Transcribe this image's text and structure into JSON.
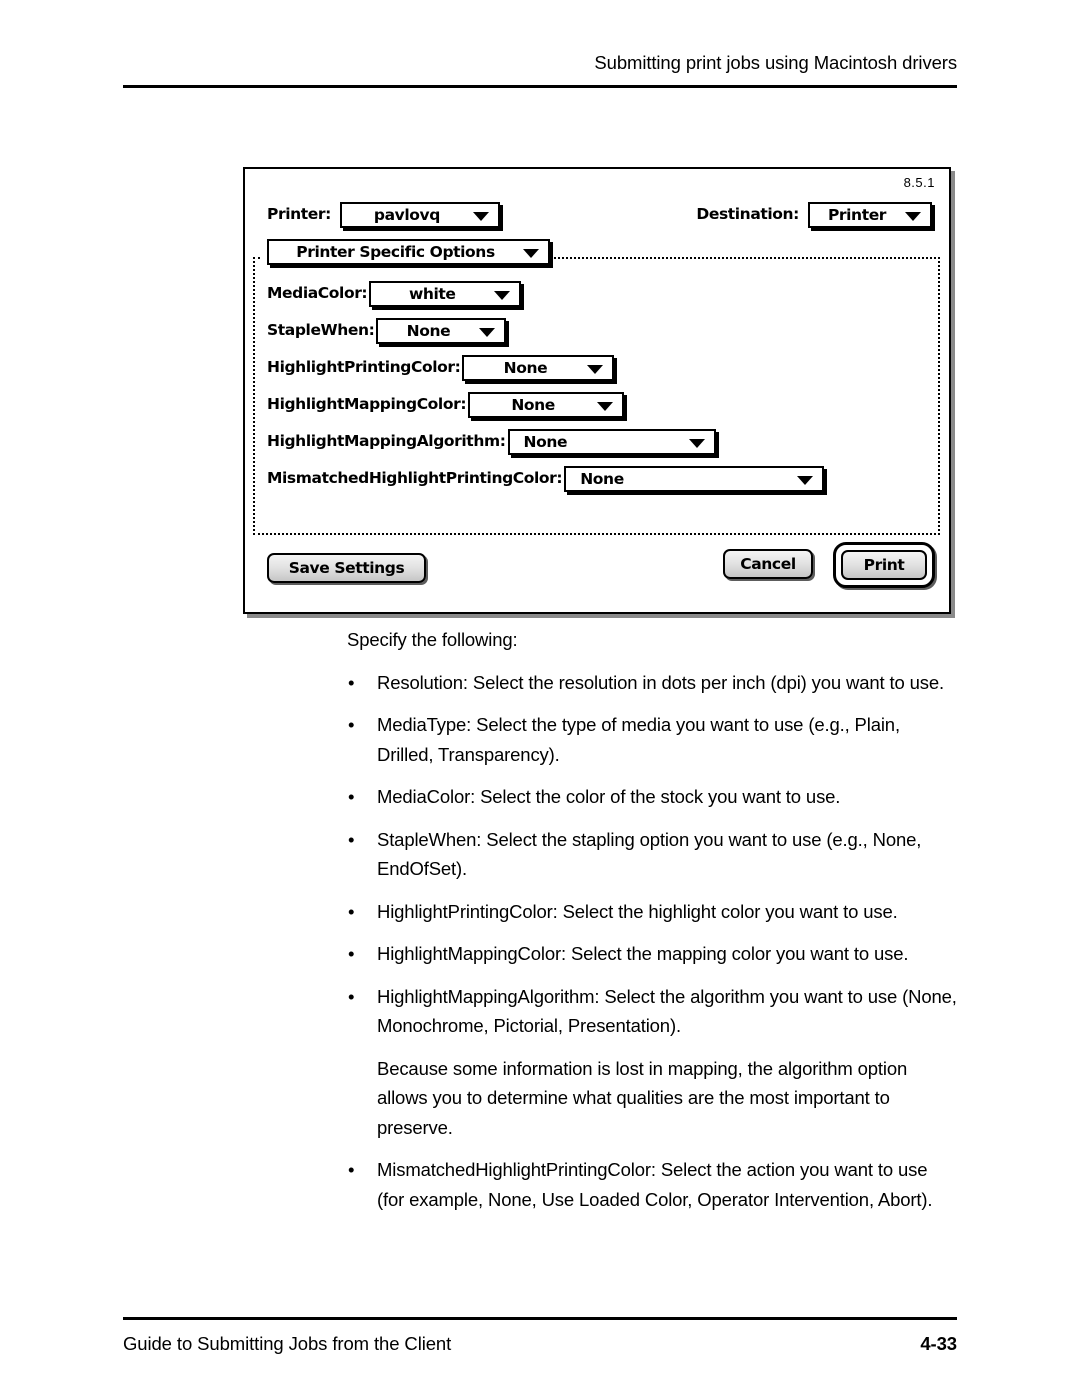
{
  "page": {
    "header_title": "Submitting print jobs using Macintosh drivers",
    "footer_left": "Guide to Submitting Jobs from the Client",
    "footer_page": "4-33"
  },
  "dialog": {
    "version": "8.5.1",
    "printer_label": "Printer:",
    "printer_value": "pavlovq",
    "destination_label": "Destination:",
    "destination_value": "Printer",
    "pane_popup": "Printer Specific Options",
    "options": [
      {
        "label": "MediaColor:",
        "value": "white",
        "field_width": 152,
        "align": "center"
      },
      {
        "label": "StapleWhen:",
        "value": "None",
        "field_width": 130,
        "align": "center"
      },
      {
        "label": "HighlightPrintingColor:",
        "value": "None",
        "field_width": 152,
        "align": "center"
      },
      {
        "label": "HighlightMappingColor:",
        "value": "None",
        "field_width": 156,
        "align": "center"
      },
      {
        "label": "HighlightMappingAlgorithm:",
        "value": "None",
        "field_width": 208,
        "align": "lead"
      },
      {
        "label": "MismatchedHighlightPrintingColor:",
        "value": "None",
        "field_width": 260,
        "align": "lead"
      }
    ],
    "save_label": "Save Settings",
    "cancel_label": "Cancel",
    "print_label": "Print"
  },
  "content": {
    "intro": "Specify the following:",
    "bullet_char": "•",
    "bullets": [
      {
        "text": "Resolution: Select the resolution in dots per inch (dpi) you want to use."
      },
      {
        "text": "MediaType: Select the type of media you want to use (e.g., Plain, Drilled, Transparency)."
      },
      {
        "text": "MediaColor: Select the color of the stock you want to use."
      },
      {
        "text": "StapleWhen: Select the stapling option you want to use (e.g., None, EndOfSet)."
      },
      {
        "text": "HighlightPrintingColor: Select the highlight color you want to use."
      },
      {
        "text": "HighlightMappingColor: Select the mapping color you want to use."
      },
      {
        "text": "HighlightMappingAlgorithm: Select the algorithm you want to use (None, Monochrome, Pictorial, Presentation).",
        "note": "Because some information is lost in mapping, the algorithm option allows you to determine what qualities are the most important to preserve."
      },
      {
        "text": "MismatchedHighlightPrintingColor: Select the action you want to use (for example, None, Use Loaded Color, Operator Intervention, Abort)."
      }
    ]
  }
}
